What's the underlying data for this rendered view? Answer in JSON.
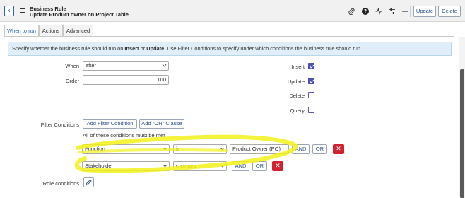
{
  "header": {
    "type_label": "Business Rule",
    "record_name": "Update Product owner on Project Table",
    "update_label": "Update",
    "delete_label": "Delete",
    "icons": [
      "back-icon",
      "menu-icon",
      "attachment-icon",
      "help-icon",
      "activity-icon",
      "settings-icon",
      "more-icon"
    ]
  },
  "tabs": [
    {
      "label": "When to run",
      "active": true
    },
    {
      "label": "Actions",
      "active": false
    },
    {
      "label": "Advanced",
      "active": false
    }
  ],
  "info": {
    "prefix": "Specify whether the business rule should run on ",
    "insert": "Insert",
    "or": " or ",
    "update": "Update",
    "suffix": ". Use Filter Conditions to specify under which conditions the business rule should run."
  },
  "form": {
    "when_label": "When",
    "when_value": "after",
    "order_label": "Order",
    "order_value": "100",
    "insert_label": "Insert",
    "insert_checked": true,
    "update_label": "Update",
    "update_checked": true,
    "delete_label": "Delete",
    "delete_checked": false,
    "query_label": "Query",
    "query_checked": false
  },
  "filter": {
    "label": "Filter Conditions",
    "add_filter_label": "Add Filter Condition",
    "add_or_label": "Add \"OR\" Clause",
    "note": "All of these conditions must be met",
    "conditions": [
      {
        "field": "Function",
        "operator": "is",
        "value": "Product Owner (PO)",
        "and": "AND",
        "or": "OR"
      },
      {
        "field": "Stakeholder",
        "operator": "changes",
        "value": "",
        "and": "AND",
        "or": "OR"
      }
    ],
    "delete_glyph": "✕"
  },
  "role": {
    "label": "Role conditions"
  },
  "colors": {
    "accent": "#2d63c7",
    "checkbox": "#4b4fb8",
    "delete": "#d3212d",
    "info_bg": "#dfeef8",
    "highlight": "#f2f21a"
  }
}
